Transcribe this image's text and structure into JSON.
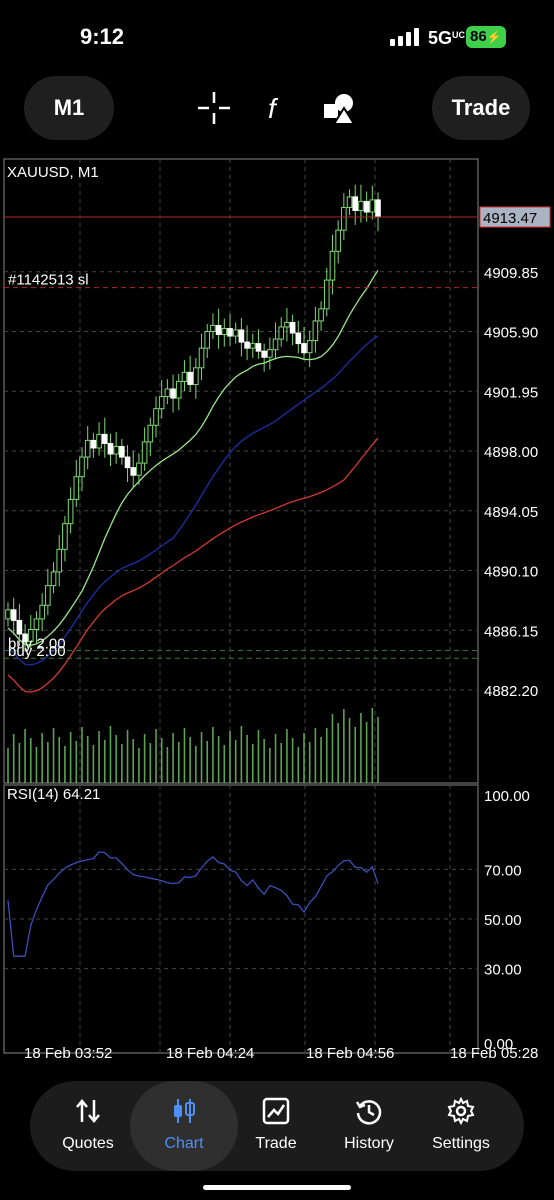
{
  "status_bar": {
    "time": "9:12",
    "network": "5G",
    "network_sub": "UC",
    "battery": "86"
  },
  "toolbar": {
    "timeframe": "M1",
    "trade_label": "Trade"
  },
  "chart": {
    "symbol_label": "XAUUSD, M1",
    "current_price": "4913.47",
    "sl_label": "#1142513 sl",
    "buy_label_1": "buy 2.00",
    "buy_label_2": "buy 2.00",
    "price_ticks": [
      "4909.85",
      "4905.90",
      "4901.95",
      "4898.00",
      "4894.05",
      "4890.10",
      "4886.15",
      "4882.20"
    ],
    "rsi_label": "RSI(14) 64.21",
    "rsi_ticks": [
      "100.00",
      "70.00",
      "50.00",
      "30.00",
      "0.00"
    ],
    "time_ticks": [
      "18 Feb 03:52",
      "18 Feb 04:24",
      "18 Feb 04:56",
      "18 Feb 05:28"
    ],
    "colors": {
      "bull": "#7cd870",
      "ma_fast": "#9ae68a",
      "ma_mid": "#1c2fa8",
      "ma_slow": "#d13a32",
      "sl_line": "#b02a2a",
      "price_tag": "#aab4c2",
      "grid": "#444444",
      "rsi": "#3a4fb8",
      "volume": "#7cd870"
    }
  },
  "chart_data": {
    "type": "candlestick",
    "symbol": "XAUUSD",
    "timeframe": "M1",
    "price_axis": [
      4882.2,
      4886.15,
      4890.1,
      4894.05,
      4898.0,
      4901.95,
      4905.9,
      4909.85
    ],
    "last_price": 4913.47,
    "rsi_period": 14,
    "rsi_value": 64.21,
    "rsi_levels": [
      30,
      50,
      70
    ],
    "close": [
      4887.5,
      4886.8,
      4885.9,
      4885.4,
      4886.2,
      4886.9,
      4887.8,
      4889.1,
      4890.0,
      4891.5,
      4893.2,
      4894.8,
      4896.3,
      4897.6,
      4898.7,
      4898.2,
      4899.1,
      4898.5,
      4897.8,
      4898.3,
      4897.6,
      4896.9,
      4896.4,
      4897.2,
      4898.6,
      4899.7,
      4900.8,
      4901.6,
      4902.1,
      4901.5,
      4902.6,
      4903.2,
      4902.4,
      4903.5,
      4904.8,
      4905.9,
      4906.3,
      4905.7,
      4906.1,
      4905.6,
      4906.0,
      4905.2,
      4904.8,
      4905.1,
      4904.6,
      4904.2,
      4904.7,
      4905.4,
      4906.2,
      4906.5,
      4905.8,
      4905.1,
      4904.5,
      4905.3,
      4906.6,
      4907.4,
      4909.3,
      4911.2,
      4912.6,
      4914.1,
      4914.8,
      4913.9,
      4914.5,
      4913.8,
      4914.6,
      4913.47
    ]
  },
  "nav": {
    "items": [
      {
        "label": "Quotes"
      },
      {
        "label": "Chart"
      },
      {
        "label": "Trade"
      },
      {
        "label": "History"
      },
      {
        "label": "Settings"
      }
    ]
  }
}
